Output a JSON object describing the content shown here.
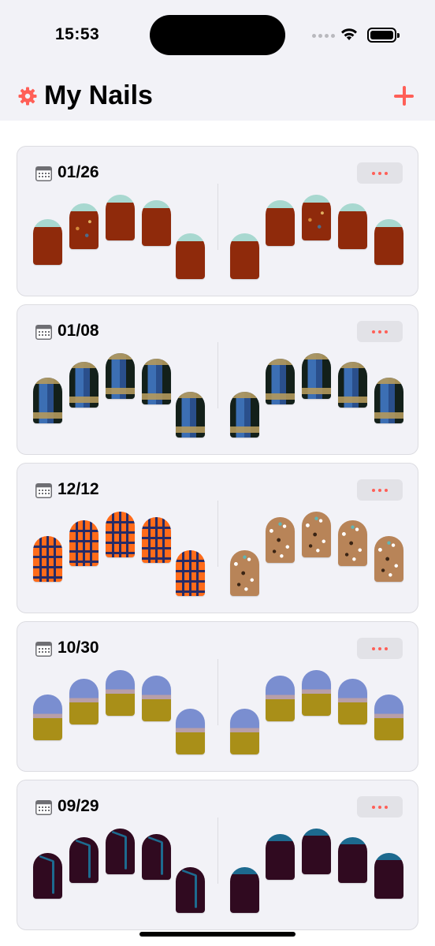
{
  "status_bar": {
    "time": "15:53"
  },
  "nav": {
    "title": "My Nails"
  },
  "entries": [
    {
      "date": "01/26",
      "left_design": "french-tip-red",
      "right_design": "french-tip-red",
      "colors": [
        "#a8d8d0",
        "#8f2a0b"
      ]
    },
    {
      "date": "01/08",
      "left_design": "galaxy-blue",
      "right_design": "galaxy-blue",
      "colors": [
        "#13201a",
        "#3c6fb4",
        "#b49a5c"
      ]
    },
    {
      "date": "12/12",
      "left_design": "orange-plaid",
      "right_design": "brown-terrazzo",
      "colors": [
        "#ff6b1a",
        "#262b66",
        "#b88458"
      ]
    },
    {
      "date": "10/30",
      "left_design": "periwinkle-gold-ombre",
      "right_design": "periwinkle-gold-ombre",
      "colors": [
        "#7a8ed0",
        "#a98f18"
      ]
    },
    {
      "date": "09/29",
      "left_design": "wine-blue-lines",
      "right_design": "wine-blue-tip",
      "colors": [
        "#300a20",
        "#1d6a8f"
      ]
    }
  ],
  "colors": {
    "accent": "#ff5f57",
    "background": "#f2f2f7"
  }
}
